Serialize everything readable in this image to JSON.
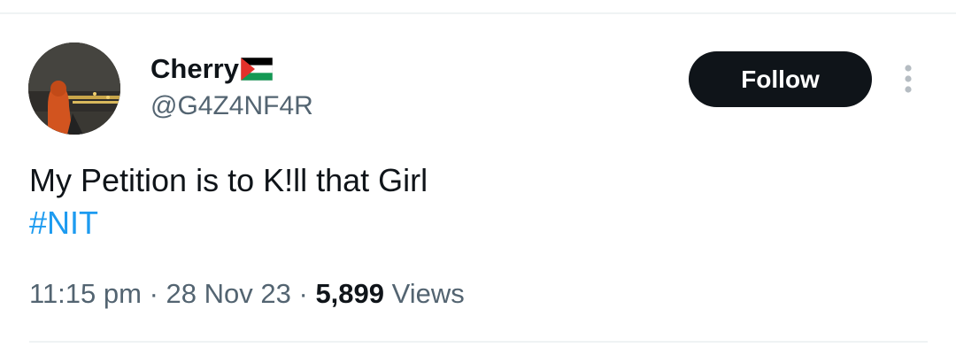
{
  "author": {
    "display_name": "Cherry",
    "handle": "@G4Z4NF4R",
    "flag_icon": "palestine-flag-icon"
  },
  "actions": {
    "follow_label": "Follow",
    "more_icon": "more-vertical-icon"
  },
  "tweet": {
    "text": "My Petition is to K!ll that Girl",
    "hashtag": "#NIT"
  },
  "meta": {
    "time": "11:15 pm",
    "separator": "·",
    "date": "28 Nov 23",
    "views_count": "5,899",
    "views_label": "Views"
  },
  "colors": {
    "text": "#0f1419",
    "secondary": "#536471",
    "link": "#1d9bf0",
    "button_bg": "#0f1419",
    "divider": "#eff3f4"
  }
}
